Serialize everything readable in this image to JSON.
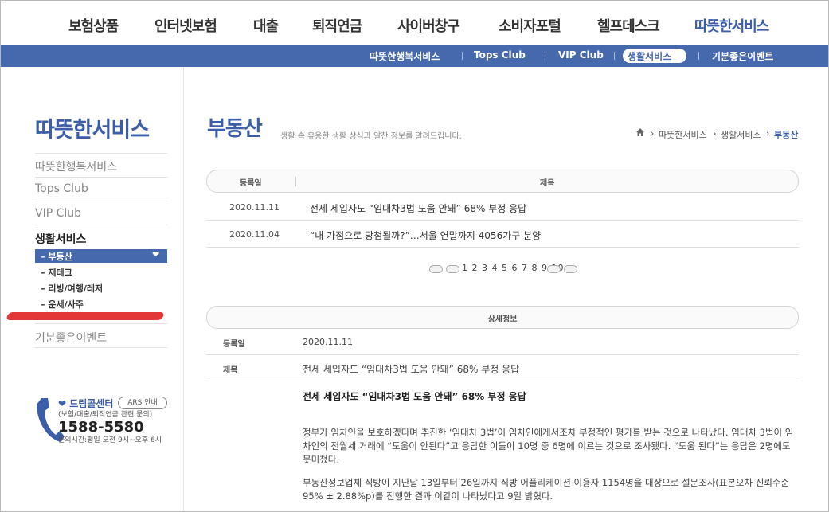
{
  "topnav": {
    "items": [
      "보험상품",
      "인터넷보험",
      "대출",
      "퇴직연금",
      "사이버창구",
      "소비자포털",
      "헬프데스크",
      "따뜻한서비스"
    ],
    "active_index": 7
  },
  "subnav": {
    "items": [
      "따뜻한행복서비스",
      "Tops Club",
      "VIP Club",
      "생활서비스",
      "기분좋은이벤트"
    ],
    "active_index": 3
  },
  "sidebar": {
    "title": "따뜻한서비스",
    "links": [
      "따뜻한행복서비스",
      "Tops Club",
      "VIP Club",
      "생활서비스"
    ],
    "sub_items": [
      "부동산",
      "재테크",
      "리빙/여행/레저",
      "운세/사주"
    ],
    "sub_active_index": 0,
    "bottom_link": "기분좋은이벤트",
    "call_center": {
      "title": "드림콜센터",
      "ars": "ARS 안내",
      "desc": "(보험/대출/퇴직연금 관련 문의)",
      "number": "1588-5580",
      "hours": "문의시간:평일 오전 9시~오후 6시"
    }
  },
  "page": {
    "title": "부동산",
    "desc": "생활 속 유용한 생활 상식과 알찬 정보를 알려드립니다.",
    "breadcrumb": [
      "따뜻한서비스",
      "생활서비스",
      "부동산"
    ]
  },
  "list": {
    "headers": {
      "date": "등록일",
      "title": "제목"
    },
    "rows": [
      {
        "date": "2020.11.11",
        "title": "전세 세입자도 “임대차3법 도움 안돼” 68% 부정 응답"
      },
      {
        "date": "2020.11.04",
        "title": "“내 가점으로 당첨될까?”…서울 연말까지 4056가구 분양"
      }
    ]
  },
  "pager": {
    "pages": "1 2 3 4 5 6 7 8 9 10"
  },
  "detail": {
    "header": "상세정보",
    "date_label": "등록일",
    "date": "2020.11.11",
    "title_label": "제목",
    "title": "전세 세입자도 “임대차3법 도움 안돼” 68% 부정 응답",
    "body_title": "전세 세입자도 “임대차3법 도움 안돼” 68% 부정 응답",
    "para1": "정부가 임차인을 보호하겠다며 추진한 ‘임대차 3법’이 임차인에게서조차 부정적인 평가를 받는 것으로 나타났다. 임대차 3법이 임차인의 전월세 거래에 “도움이 안된다”고 응답한 이들이 10명 중 6명에 이르는 것으로 조사됐다. “도움 된다”는 응답은 2명에도 못미쳤다.",
    "para2": "부동산정보업체 직방이 지난달 13일부터 26일까지 직방 어플리케이션 이용자 1154명을 대상으로 설문조사(표본오차 신뢰수준 95% ± 2.88%p)를 진행한 결과 이같이 나타났다고 9일 밝혔다."
  },
  "colors": {
    "brand": "#4668ad",
    "title_blue": "#3c5ea8"
  }
}
